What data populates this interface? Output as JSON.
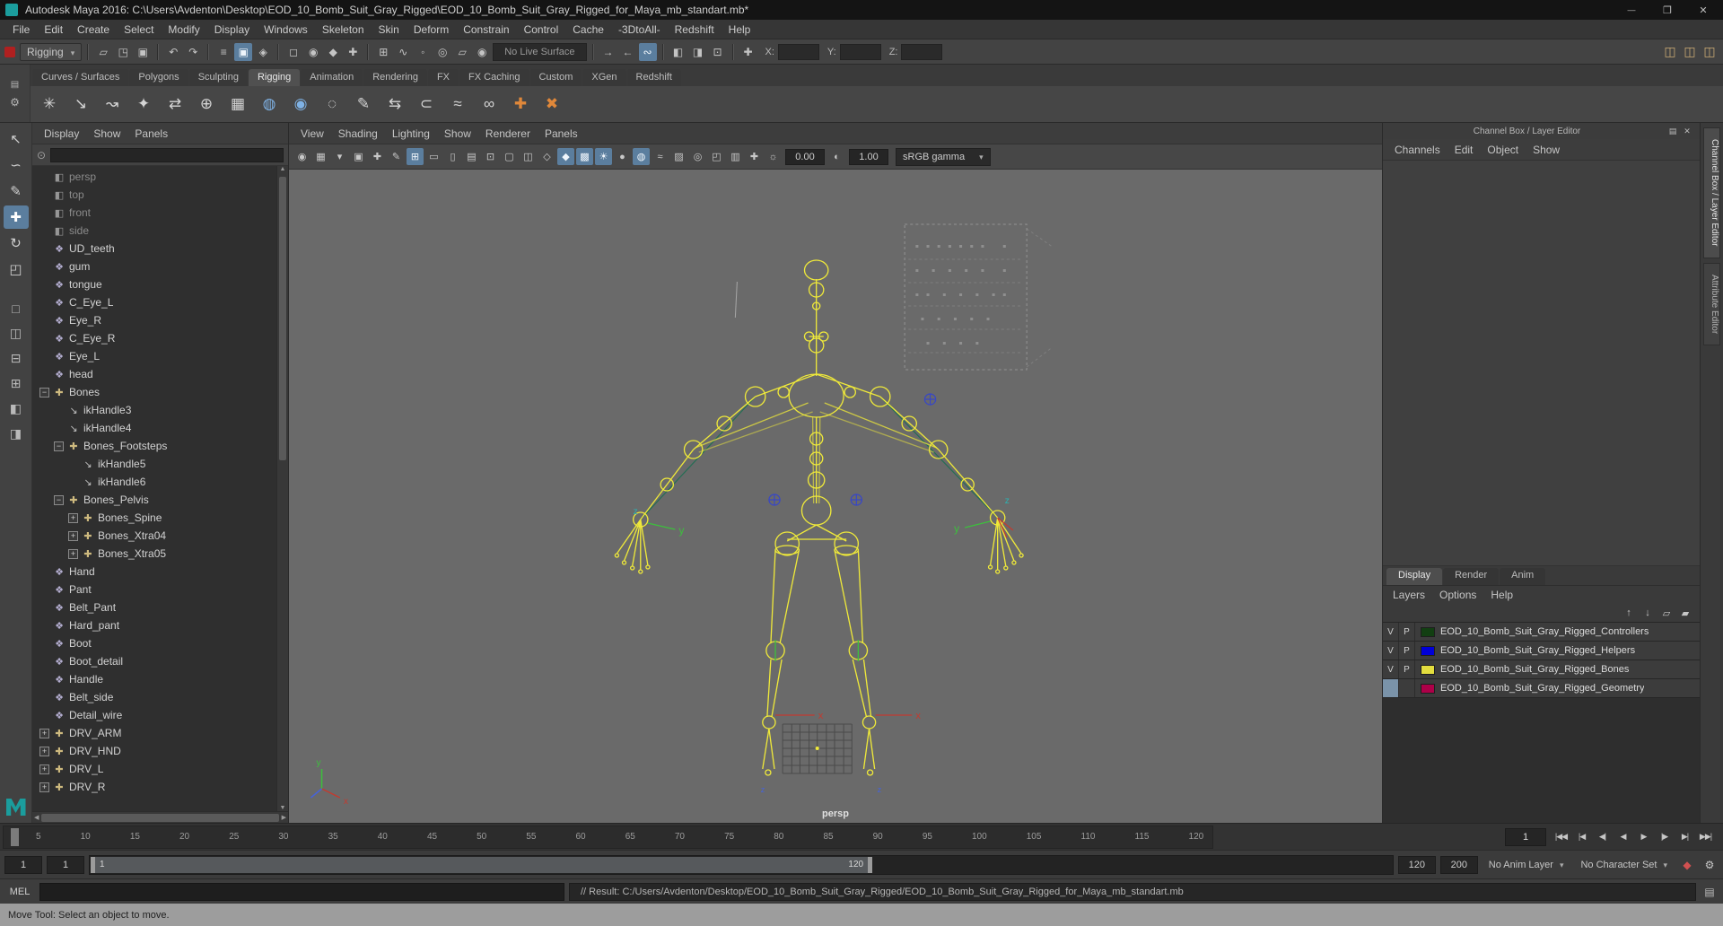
{
  "window": {
    "title": "Autodesk Maya 2016: C:\\Users\\Avdenton\\Desktop\\EOD_10_Bomb_Suit_Gray_Rigged\\EOD_10_Bomb_Suit_Gray_Rigged_for_Maya_mb_standart.mb*"
  },
  "menubar": {
    "items": [
      "File",
      "Edit",
      "Create",
      "Select",
      "Modify",
      "Display",
      "Windows",
      "Skeleton",
      "Skin",
      "Deform",
      "Constrain",
      "Control",
      "Cache",
      "-3DtoAll-",
      "Redshift",
      "Help"
    ]
  },
  "statusline": {
    "menuset": "Rigging",
    "live_surface": "No Live Surface",
    "x_label": "X:",
    "y_label": "Y:",
    "z_label": "Z:",
    "x_value": "",
    "y_value": "",
    "z_value": "",
    "file_icons": [
      {
        "n": "new-scene-icon",
        "g": "▱"
      },
      {
        "n": "open-scene-icon",
        "g": "◳"
      },
      {
        "n": "save-scene-icon",
        "g": "▣"
      }
    ],
    "undo_icons": [
      {
        "n": "undo-icon",
        "g": "↶"
      },
      {
        "n": "redo-icon",
        "g": "↷"
      }
    ],
    "selectmode_icons": [
      {
        "n": "select-hierarchy-mode-icon",
        "g": "≡"
      },
      {
        "n": "select-object-mode-icon",
        "g": "▣",
        "active": true
      },
      {
        "n": "select-component-mode-icon",
        "g": "◈"
      }
    ],
    "mask_icons": [
      {
        "n": "select-all-mask-icon",
        "g": "◻"
      },
      {
        "n": "select-handles-mask-icon",
        "g": "◉"
      },
      {
        "n": "select-joints-mask-icon",
        "g": "◆"
      },
      {
        "n": "select-curves-mask-icon",
        "g": "✚"
      }
    ],
    "snap_icons": [
      {
        "n": "snap-to-grid-icon",
        "g": "⊞"
      },
      {
        "n": "snap-to-curve-icon",
        "g": "∿"
      },
      {
        "n": "snap-to-point-icon",
        "g": "◦"
      },
      {
        "n": "snap-to-projected-center-icon",
        "g": "◎"
      },
      {
        "n": "snap-to-view-plane-icon",
        "g": "▱"
      },
      {
        "n": "make-live-icon",
        "g": "◉"
      }
    ],
    "history_icons": [
      {
        "n": "input-connections-icon",
        "g": "→"
      },
      {
        "n": "output-connections-icon",
        "g": "←"
      },
      {
        "n": "construction-history-icon",
        "g": "∾",
        "active": true
      }
    ],
    "render_icons": [
      {
        "n": "render-current-frame-icon",
        "g": "◧"
      },
      {
        "n": "ipr-render-icon",
        "g": "◨"
      },
      {
        "n": "render-settings-icon",
        "g": "⊡"
      }
    ],
    "xyz_icon": {
      "n": "quick-select-icon",
      "g": "✚"
    },
    "panel_toggle_icons": [
      {
        "n": "modeling-toolkit-toggle-icon",
        "g": "◫"
      },
      {
        "n": "attribute-editor-toggle-icon",
        "g": "◫"
      },
      {
        "n": "channel-box-toggle-icon",
        "g": "◫"
      }
    ]
  },
  "shelf": {
    "tabs": [
      {
        "label": "Curves / Surfaces"
      },
      {
        "label": "Polygons"
      },
      {
        "label": "Sculpting"
      },
      {
        "label": "Rigging",
        "active": true
      },
      {
        "label": "Animation"
      },
      {
        "label": "Rendering"
      },
      {
        "label": "FX"
      },
      {
        "label": "FX Caching"
      },
      {
        "label": "Custom"
      },
      {
        "label": "XGen"
      },
      {
        "label": "Redshift"
      }
    ],
    "icons": [
      {
        "n": "joint-tool-icon",
        "g": "✳"
      },
      {
        "n": "ik-handle-tool-icon",
        "g": "↘"
      },
      {
        "n": "ik-spline-handle-tool-icon",
        "g": "↝"
      },
      {
        "n": "insert-joint-icon",
        "g": "✦"
      },
      {
        "n": "mirror-joint-icon",
        "g": "⇄"
      },
      {
        "n": "orient-joint-icon",
        "g": "⊕"
      },
      {
        "n": "bind-skin-icon",
        "g": "▦"
      },
      {
        "n": "interactive-bind-icon",
        "g": "◍",
        "c": "#7fb2e5"
      },
      {
        "n": "geodesic-voxel-bind-icon",
        "g": "◉",
        "c": "#7fb2e5"
      },
      {
        "n": "detach-skin-icon",
        "g": "◌"
      },
      {
        "n": "paint-skin-weights-icon",
        "g": "✎"
      },
      {
        "n": "mirror-skin-weights-icon",
        "g": "⇆"
      },
      {
        "n": "copy-skin-weights-icon",
        "g": "⊂"
      },
      {
        "n": "smooth-skin-weights-icon",
        "g": "≈"
      },
      {
        "n": "pose-glasses-icon",
        "g": "∞"
      },
      {
        "n": "add-joint-icon",
        "g": "✚",
        "c": "#e0883a"
      },
      {
        "n": "remove-joint-icon",
        "g": "✖",
        "c": "#e0883a"
      }
    ]
  },
  "toolbox": {
    "tools": [
      {
        "n": "select-tool",
        "g": "↖"
      },
      {
        "n": "lasso-select-tool",
        "g": "∽"
      },
      {
        "n": "paint-select-tool",
        "g": "✎"
      },
      {
        "n": "move-tool",
        "g": "✚",
        "active": true
      },
      {
        "n": "rotate-tool",
        "g": "↻"
      },
      {
        "n": "scale-tool",
        "g": "◰"
      }
    ],
    "layouts": [
      {
        "n": "layout-single-pane",
        "g": "□"
      },
      {
        "n": "layout-two-panes-side",
        "g": "◫"
      },
      {
        "n": "layout-two-panes-stacked",
        "g": "⊟"
      },
      {
        "n": "layout-four-panes",
        "g": "⊞"
      },
      {
        "n": "layout-three-panes-left",
        "g": "◧"
      },
      {
        "n": "layout-three-panes-right",
        "g": "◨"
      }
    ]
  },
  "outliner": {
    "menus": [
      "Display",
      "Show",
      "Panels"
    ],
    "search_value": "",
    "items": [
      {
        "name": "persp",
        "icon": "camera",
        "depth": 0,
        "exp": "",
        "dim": true
      },
      {
        "name": "top",
        "icon": "camera",
        "depth": 0,
        "exp": "",
        "dim": true
      },
      {
        "name": "front",
        "icon": "camera",
        "depth": 0,
        "exp": "",
        "dim": true
      },
      {
        "name": "side",
        "icon": "camera",
        "depth": 0,
        "exp": "",
        "dim": true
      },
      {
        "name": "UD_teeth",
        "icon": "mesh",
        "depth": 0,
        "exp": ""
      },
      {
        "name": "gum",
        "icon": "mesh",
        "depth": 0,
        "exp": ""
      },
      {
        "name": "tongue",
        "icon": "mesh",
        "depth": 0,
        "exp": ""
      },
      {
        "name": "C_Eye_L",
        "icon": "mesh",
        "depth": 0,
        "exp": ""
      },
      {
        "name": "Eye_R",
        "icon": "mesh",
        "depth": 0,
        "exp": ""
      },
      {
        "name": "C_Eye_R",
        "icon": "mesh",
        "depth": 0,
        "exp": ""
      },
      {
        "name": "Eye_L",
        "icon": "mesh",
        "depth": 0,
        "exp": ""
      },
      {
        "name": "head",
        "icon": "mesh",
        "depth": 0,
        "exp": ""
      },
      {
        "name": "Bones",
        "icon": "joint",
        "depth": 0,
        "exp": "minus"
      },
      {
        "name": "ikHandle3",
        "icon": "ik",
        "depth": 1,
        "exp": ""
      },
      {
        "name": "ikHandle4",
        "icon": "ik",
        "depth": 1,
        "exp": ""
      },
      {
        "name": "Bones_Footsteps",
        "icon": "joint",
        "depth": 1,
        "exp": "minus"
      },
      {
        "name": "ikHandle5",
        "icon": "ik",
        "depth": 2,
        "exp": ""
      },
      {
        "name": "ikHandle6",
        "icon": "ik",
        "depth": 2,
        "exp": ""
      },
      {
        "name": "Bones_Pelvis",
        "icon": "joint",
        "depth": 1,
        "exp": "minus"
      },
      {
        "name": "Bones_Spine",
        "icon": "joint",
        "depth": 2,
        "exp": "plus"
      },
      {
        "name": "Bones_Xtra04",
        "icon": "joint",
        "depth": 2,
        "exp": "plus"
      },
      {
        "name": "Bones_Xtra05",
        "icon": "joint",
        "depth": 2,
        "exp": "plus"
      },
      {
        "name": "Hand",
        "icon": "mesh",
        "depth": 0,
        "exp": ""
      },
      {
        "name": "Pant",
        "icon": "mesh",
        "depth": 0,
        "exp": ""
      },
      {
        "name": "Belt_Pant",
        "icon": "mesh",
        "depth": 0,
        "exp": ""
      },
      {
        "name": "Hard_pant",
        "icon": "mesh",
        "depth": 0,
        "exp": ""
      },
      {
        "name": "Boot",
        "icon": "mesh",
        "depth": 0,
        "exp": ""
      },
      {
        "name": "Boot_detail",
        "icon": "mesh",
        "depth": 0,
        "exp": ""
      },
      {
        "name": "Handle",
        "icon": "mesh",
        "depth": 0,
        "exp": ""
      },
      {
        "name": "Belt_side",
        "icon": "mesh",
        "depth": 0,
        "exp": ""
      },
      {
        "name": "Detail_wire",
        "icon": "mesh",
        "depth": 0,
        "exp": ""
      },
      {
        "name": "DRV_ARM",
        "icon": "joint",
        "depth": 0,
        "exp": "plus"
      },
      {
        "name": "DRV_HND",
        "icon": "joint",
        "depth": 0,
        "exp": "plus"
      },
      {
        "name": "DRV_L",
        "icon": "joint",
        "depth": 0,
        "exp": "plus"
      },
      {
        "name": "DRV_R",
        "icon": "joint",
        "depth": 0,
        "exp": "plus"
      }
    ]
  },
  "viewport": {
    "menus": [
      "View",
      "Shading",
      "Lighting",
      "Show",
      "Renderer",
      "Panels"
    ],
    "toolbar_icons": [
      {
        "n": "camera-lock-icon",
        "g": "◉"
      },
      {
        "n": "camera-attributes-icon",
        "g": "▦"
      },
      {
        "n": "bookmark-icon",
        "g": "▾"
      },
      {
        "n": "image-plane-icon",
        "g": "▣"
      },
      {
        "n": "pan-zoom-icon",
        "g": "✚"
      },
      {
        "n": "grease-pencil-icon",
        "g": "✎"
      },
      {
        "n": "grid-toggle-icon",
        "g": "⊞",
        "active": true
      },
      {
        "n": "film-gate-icon",
        "g": "▭"
      },
      {
        "n": "resolution-gate-icon",
        "g": "▯"
      },
      {
        "n": "gate-mask-icon",
        "g": "▤"
      },
      {
        "n": "field-chart-icon",
        "g": "⊡"
      },
      {
        "n": "safe-action-icon",
        "g": "▢"
      },
      {
        "n": "safe-title-icon",
        "g": "◫"
      },
      {
        "n": "wireframe-mode-icon",
        "g": "◇"
      },
      {
        "n": "shaded-mode-icon",
        "g": "◆",
        "active": true
      },
      {
        "n": "textured-mode-icon",
        "g": "▩",
        "active": true
      },
      {
        "n": "lighting-icon",
        "g": "☀",
        "active": true
      },
      {
        "n": "shadows-icon",
        "g": "●"
      },
      {
        "n": "ambient-occlusion-icon",
        "g": "◍",
        "active": true
      },
      {
        "n": "motion-blur-icon",
        "g": "≈"
      },
      {
        "n": "multisample-aa-icon",
        "g": "▨"
      },
      {
        "n": "depth-of-field-icon",
        "g": "◎"
      },
      {
        "n": "isolate-select-icon",
        "g": "◰"
      },
      {
        "n": "xray-icon",
        "g": "▥"
      },
      {
        "n": "xray-joints-icon",
        "g": "✚"
      }
    ],
    "exposure_icon": "☼",
    "contrast_icon": "◐",
    "exposure": "0.00",
    "gamma": "1.00",
    "colorspace": "sRGB gamma",
    "camera_label": "persp",
    "axis": {
      "x": "x",
      "y": "y",
      "z": "z"
    }
  },
  "channelbox": {
    "header": "Channel Box / Layer Editor",
    "header_icons": [
      {
        "n": "pane-menu-icon",
        "g": "▤"
      },
      {
        "n": "pane-close-icon",
        "g": "✕"
      }
    ],
    "menus": [
      "Channels",
      "Edit",
      "Object",
      "Show"
    ],
    "layer_tabs": [
      {
        "label": "Display",
        "active": true
      },
      {
        "label": "Render"
      },
      {
        "label": "Anim"
      }
    ],
    "layer_menus": [
      "Layers",
      "Options",
      "Help"
    ],
    "layer_toolbar": [
      {
        "n": "layer-move-up-icon",
        "g": "↑"
      },
      {
        "n": "layer-move-down-icon",
        "g": "↓"
      },
      {
        "n": "create-empty-layer-icon",
        "g": "▱"
      },
      {
        "n": "create-layer-from-selected-icon",
        "g": "▰"
      }
    ],
    "layers": [
      {
        "v": "V",
        "p": "P",
        "color": "#123f12",
        "name": "EOD_10_Bomb_Suit_Gray_Rigged_Controllers"
      },
      {
        "v": "V",
        "p": "P",
        "color": "#0000d8",
        "name": "EOD_10_Bomb_Suit_Gray_Rigged_Helpers"
      },
      {
        "v": "V",
        "p": "P",
        "color": "#e3dd3e",
        "name": "EOD_10_Bomb_Suit_Gray_Rigged_Bones"
      },
      {
        "v": "",
        "p": "",
        "color": "#ad0048",
        "name": "EOD_10_Bomb_Suit_Gray_Rigged_Geometry",
        "selected": true
      }
    ]
  },
  "side_tabs": [
    {
      "label": "Channel Box / Layer Editor",
      "active": true
    },
    {
      "label": "Attribute Editor"
    }
  ],
  "timeline": {
    "ticks": [
      "5",
      "10",
      "15",
      "20",
      "25",
      "30",
      "35",
      "40",
      "45",
      "50",
      "55",
      "60",
      "65",
      "70",
      "75",
      "80",
      "85",
      "90",
      "95",
      "100",
      "105",
      "110",
      "115",
      "120"
    ],
    "current_frame": "1",
    "playback_icons": [
      {
        "n": "go-to-start-button",
        "g": "|◀◀"
      },
      {
        "n": "step-back-key-button",
        "g": "|◀"
      },
      {
        "n": "step-back-frame-button",
        "g": "◀|"
      },
      {
        "n": "play-backwards-button",
        "g": "◀"
      },
      {
        "n": "play-forward-button",
        "g": "▶"
      },
      {
        "n": "step-forward-frame-button",
        "g": "|▶"
      },
      {
        "n": "step-forward-key-button",
        "g": "▶|"
      },
      {
        "n": "go-to-end-button",
        "g": "▶▶|"
      }
    ]
  },
  "rangebar": {
    "start": "1",
    "min": "1",
    "bar_start": "1",
    "bar_end": "120",
    "end": "120",
    "max": "200",
    "anim_layer": "No Anim Layer",
    "character_set": "No Character Set",
    "icons": [
      {
        "n": "auto-keyframe-icon",
        "g": "◆",
        "c": "#d05050"
      },
      {
        "n": "animation-preferences-icon",
        "g": "⚙"
      }
    ]
  },
  "command": {
    "label": "MEL",
    "input_value": "",
    "result": "// Result: C:/Users/Avdenton/Desktop/EOD_10_Bomb_Suit_Gray_Rigged/EOD_10_Bomb_Suit_Gray_Rigged_for_Maya_mb_standart.mb",
    "icon": {
      "n": "script-editor-icon",
      "g": "▤"
    }
  },
  "helpline": {
    "text": "Move Tool: Select an object to move."
  }
}
